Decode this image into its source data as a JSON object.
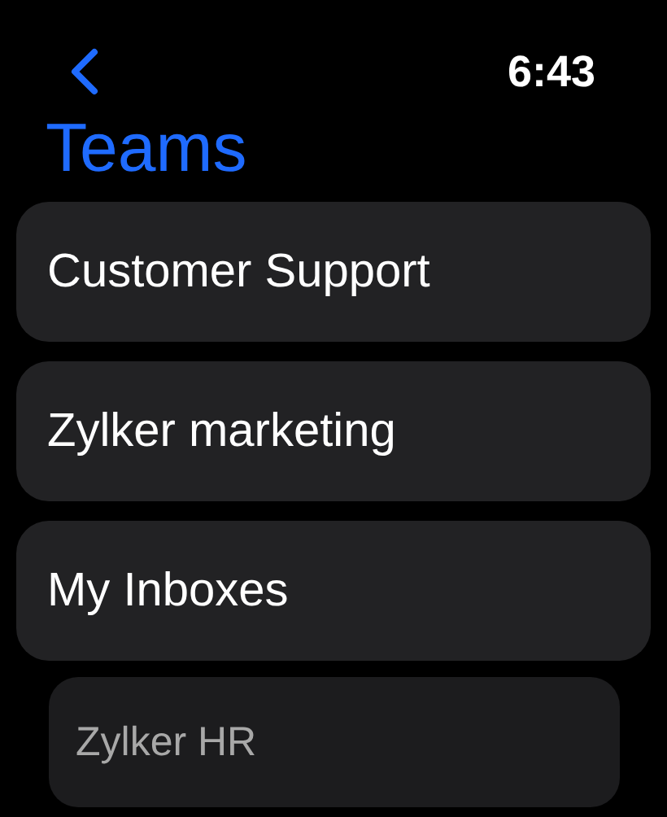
{
  "status_bar": {
    "time": "6:43"
  },
  "title": "Teams",
  "teams": [
    {
      "label": "Customer Support",
      "dimmed": false
    },
    {
      "label": "Zylker marketing",
      "dimmed": false
    },
    {
      "label": "My Inboxes",
      "dimmed": false
    },
    {
      "label": "Zylker HR",
      "dimmed": true
    }
  ]
}
